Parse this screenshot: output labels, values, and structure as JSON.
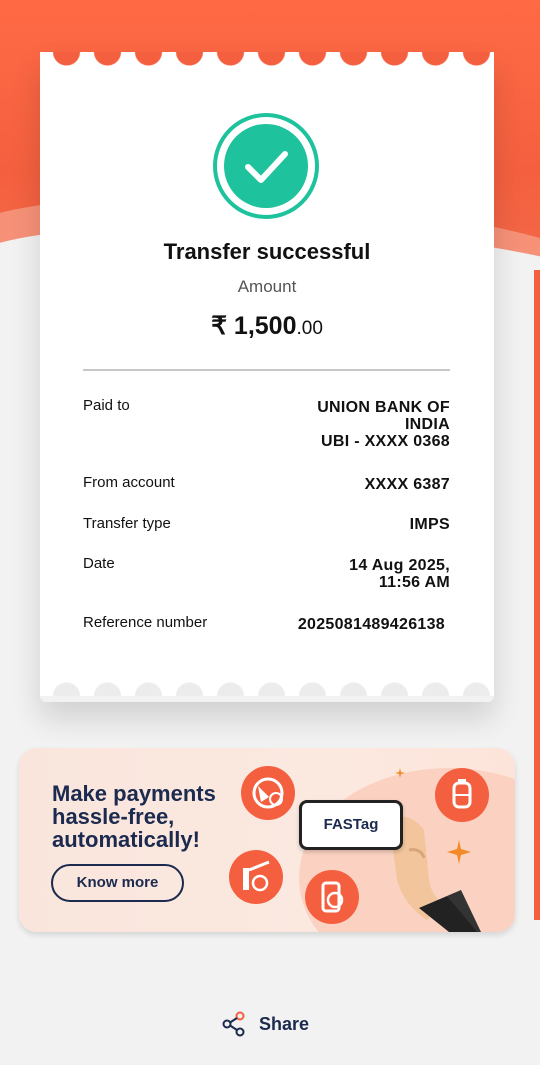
{
  "receipt": {
    "title": "Transfer successful",
    "amount_label": "Amount",
    "amount_main": "₹ 1,500",
    "amount_decimal": ".00",
    "rows": [
      {
        "label": "Paid to",
        "value_lines": [
          "UNION BANK OF",
          "INDIA",
          "UBI - XXXX 0368"
        ]
      },
      {
        "label": "From account",
        "value_lines": [
          "XXXX 6387"
        ]
      },
      {
        "label": "Transfer type",
        "value_lines": [
          "IMPS"
        ]
      },
      {
        "label": "Date",
        "value_lines": [
          "14 Aug 2025,",
          "11:56 AM"
        ]
      },
      {
        "label": "Reference number",
        "value_lines": [
          "2025081489426138"
        ]
      }
    ]
  },
  "banner": {
    "title": "Make payments hassle-free, automatically!",
    "cta": "Know more",
    "card_text": "FASTag"
  },
  "share": {
    "label": "Share",
    "icon": "share-icon"
  },
  "colors": {
    "brand_orange": "#f4603f",
    "success_green": "#1ec29c",
    "navy": "#1b2a4e"
  }
}
